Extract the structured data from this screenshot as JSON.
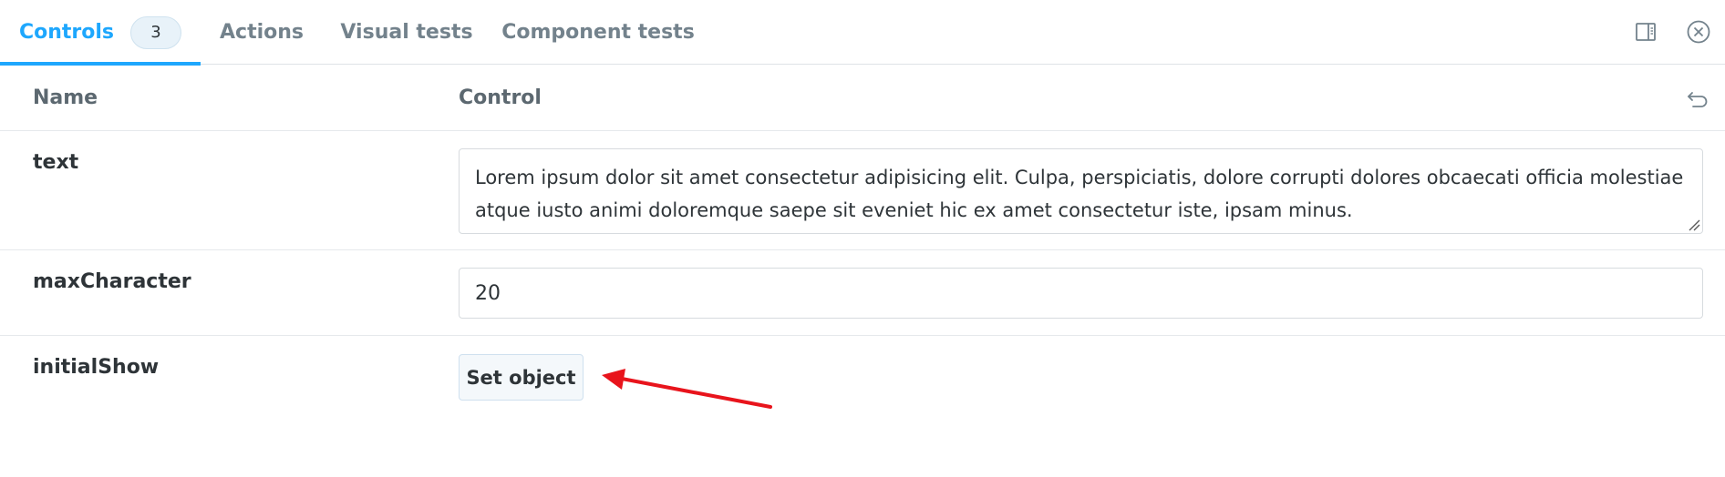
{
  "tabs": [
    {
      "label": "Controls",
      "badge": "3",
      "active": true
    },
    {
      "label": "Actions"
    },
    {
      "label": "Visual tests"
    },
    {
      "label": "Component tests"
    }
  ],
  "toolbar": {
    "toggle_panel_icon": "panel-right-icon",
    "close_icon": "close-circle-icon"
  },
  "table": {
    "name_header": "Name",
    "control_header": "Control",
    "reset_icon": "undo-icon",
    "rows": [
      {
        "name": "text",
        "control": "textarea",
        "value": "Lorem ipsum dolor sit amet consectetur adipisicing elit. Culpa, perspiciatis, dolore corrupti dolores obcaecati officia molestiae atque iusto animi doloremque saepe sit eveniet hic ex amet consectetur iste, ipsam minus."
      },
      {
        "name": "maxCharacter",
        "control": "number",
        "value": "20"
      },
      {
        "name": "initialShow",
        "control": "object",
        "button_label": "Set object"
      }
    ]
  },
  "annotation": {
    "type": "arrow",
    "color": "#e8141c",
    "points_to": "set-object-button"
  }
}
